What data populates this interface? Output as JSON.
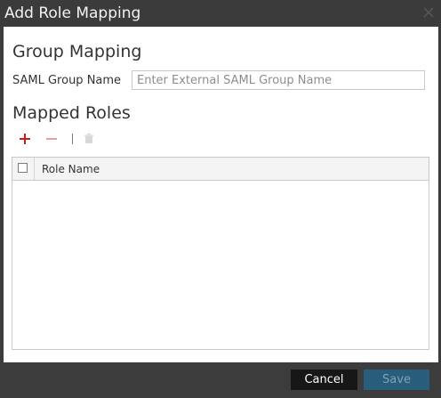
{
  "dialog": {
    "title": "Add Role Mapping",
    "close_icon": "close-icon"
  },
  "group_mapping": {
    "heading": "Group Mapping",
    "saml_label": "SAML Group Name",
    "saml_placeholder": "Enter External SAML Group Name",
    "saml_value": ""
  },
  "mapped_roles": {
    "heading": "Mapped Roles",
    "toolbar": {
      "add_icon": "plus-icon",
      "remove_icon": "minus-icon",
      "delete_icon": "trash-icon"
    },
    "table": {
      "columns": [
        "Role Name"
      ],
      "rows": []
    }
  },
  "footer": {
    "cancel_label": "Cancel",
    "save_label": "Save"
  },
  "colors": {
    "dialog_chrome": "#3c3c3c",
    "add_icon": "#c81d1d",
    "remove_icon": "#e7a0a0",
    "save_button": "#285d7b",
    "cancel_button": "#171717"
  }
}
